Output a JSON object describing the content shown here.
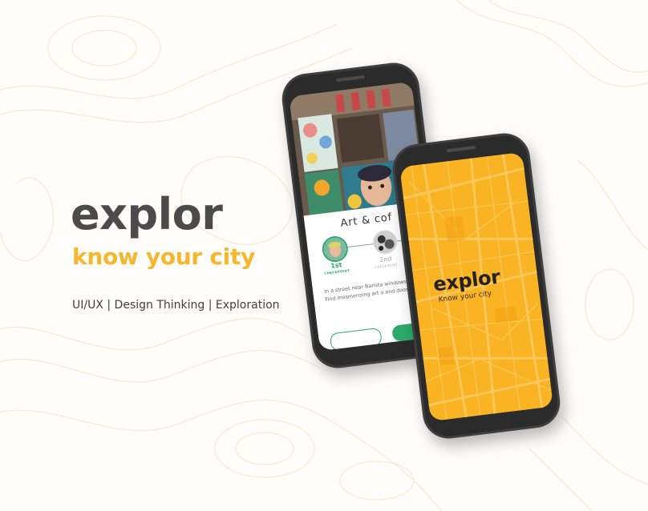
{
  "brand": {
    "title": "explor",
    "tagline": "know your city",
    "subtitle": "UI/UX | Design Thinking | Exploration"
  },
  "colors": {
    "accent": "#f7b62b",
    "title_text": "#4b4b4b",
    "phone_body": "#3e3e3e",
    "splash_bg": "#f9b323",
    "checkpoint_green": "#2ea86a"
  },
  "detail_screen": {
    "card_title": "Art & cof",
    "checkpoints": [
      {
        "number": "1st",
        "label": "CHECKPOINT",
        "active": true
      },
      {
        "number": "2nd",
        "label": "CHECKPOINT",
        "active": false
      }
    ],
    "description": "In a street near Barista windows that lead to o Find mesmerizing art o and doors of local hous"
  },
  "splash_screen": {
    "logo": "explor",
    "tagline": "Know your city"
  }
}
